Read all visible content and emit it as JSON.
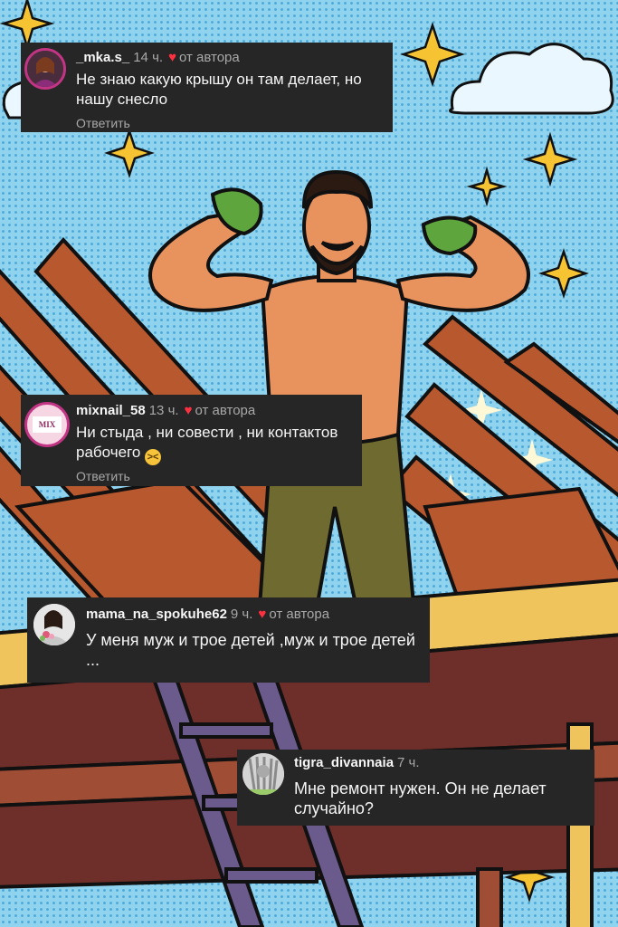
{
  "comments": [
    {
      "username": "_mka.s_",
      "time": "14 ч.",
      "author_label": "от автора",
      "text": "Не знаю какую крышу он там делает, но нашу снесло",
      "reply_label": "Ответить",
      "avatar_icon": "profile-photo-woman"
    },
    {
      "username": "mixnail_58",
      "time": "13 ч.",
      "author_label": "от автора",
      "text": "Ни стыда , ни совести , ни контактов рабочего",
      "emoji": "laughing-squint-emoji",
      "reply_label": "Ответить",
      "avatar_logo_text": "MIX"
    },
    {
      "username": "mama_na_spokuhe62",
      "time": "9 ч.",
      "author_label": "от автора",
      "text": "У меня муж  и трое детей ,муж и трое детей ...",
      "avatar_icon": "profile-photo-woman-with-flowers"
    },
    {
      "username": "tigra_divannaia",
      "time": "7 ч.",
      "text": "Мне ремонт нужен. Он не делает случайно?",
      "avatar_icon": "profile-photo-grey"
    }
  ],
  "colors": {
    "card_bg": "#262626",
    "heart": "#ff3040",
    "muted": "#a8a8a8",
    "sky": "#8fd3ef",
    "wood": "#b8582e"
  }
}
